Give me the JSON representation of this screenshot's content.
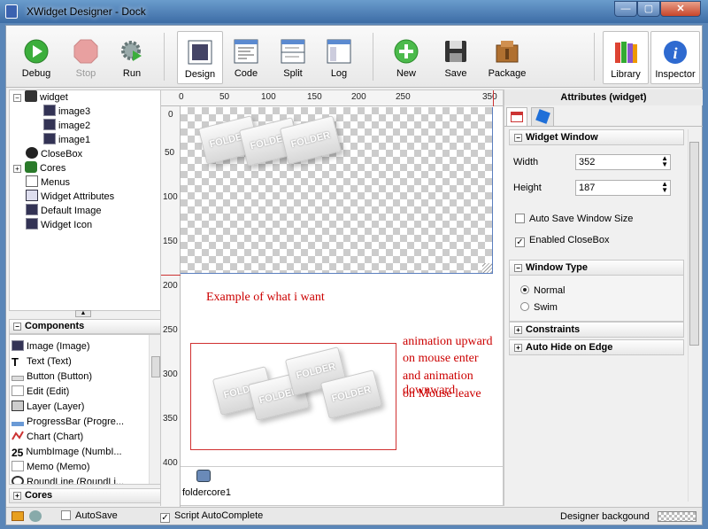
{
  "window": {
    "title": "XWidget Designer - Dock",
    "min": "—",
    "max": "▢",
    "close": "✕"
  },
  "toolbar": {
    "debug": "Debug",
    "stop": "Stop",
    "run": "Run",
    "design": "Design",
    "code": "Code",
    "split": "Split",
    "log": "Log",
    "new": "New",
    "save": "Save",
    "package": "Package",
    "library": "Library",
    "inspector": "Inspector"
  },
  "tree": {
    "widget": "widget",
    "image3": "image3",
    "image2": "image2",
    "image1": "image1",
    "closebox": "CloseBox",
    "cores": "Cores",
    "menus": "Menus",
    "widget_attributes": "Widget Attributes",
    "default_image": "Default Image",
    "widget_icon": "Widget Icon"
  },
  "components": {
    "header": "Components",
    "items": [
      "Image (Image)",
      "Text (Text)",
      "Button (Button)",
      "Edit (Edit)",
      "Layer (Layer)",
      "ProgressBar (Progre...",
      "Chart (Chart)",
      "NumbImage (NumbI...",
      "Memo (Memo)",
      "RoundLine (RoundLi..."
    ],
    "numb_icon": "25"
  },
  "cores_header": "Cores",
  "ruler": {
    "h": [
      "0",
      "50",
      "100",
      "150",
      "200",
      "250",
      "350"
    ],
    "v": [
      "0",
      "50",
      "100",
      "150",
      "200",
      "250",
      "300",
      "350",
      "400"
    ]
  },
  "canvas": {
    "folder_label": "FOLDER"
  },
  "annotation": {
    "heading": "Example of what i want",
    "line1": "animation upward",
    "line2": "on mouse enter",
    "line3": "and animation downward",
    "line4": "on Mouse leave"
  },
  "core_item": "foldercore1",
  "inspector": {
    "header": "Attributes (widget)",
    "section_window": "Widget Window",
    "width_label": "Width",
    "width_value": "352",
    "height_label": "Height",
    "height_value": "187",
    "auto_save_size": "Auto Save Window Size",
    "enabled_closebox": "Enabled CloseBox",
    "section_type": "Window Type",
    "normal": "Normal",
    "swim": "Swim",
    "section_constraints": "Constraints",
    "section_autohide": "Auto Hide on Edge"
  },
  "status": {
    "autosave": "AutoSave",
    "script_autocomplete": "Script AutoComplete",
    "designer_background": "Designer backgound"
  }
}
